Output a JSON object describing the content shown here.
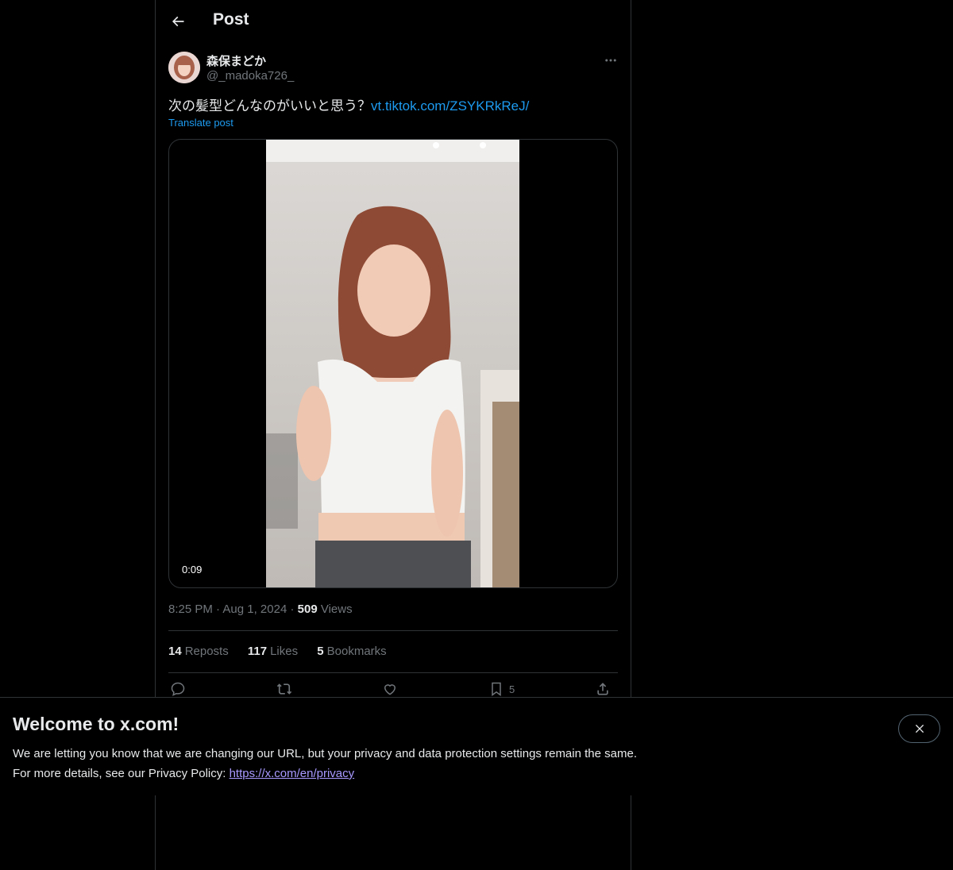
{
  "header": {
    "title": "Post",
    "back_icon": "arrow-left-icon"
  },
  "author": {
    "display_name": "森保まどか",
    "handle": "@_madoka726_"
  },
  "post": {
    "text": "次の髪型どんなのがいいと思う？",
    "link_text": "vt.tiktok.com/ZSYKRkReJ/",
    "translate_label": "Translate post"
  },
  "media": {
    "duration": "0:09"
  },
  "meta": {
    "time": "8:25 PM",
    "date": "Aug 1, 2024",
    "views_count": "509",
    "views_label": "Views",
    "sep": "·"
  },
  "stats": {
    "reposts_count": "14",
    "reposts_label": "Reposts",
    "likes_count": "117",
    "likes_label": "Likes",
    "bookmarks_count": "5",
    "bookmarks_label": "Bookmarks"
  },
  "actions": {
    "bookmark_count": "5"
  },
  "banner": {
    "title": "Welcome to x.com!",
    "line1": "We are letting you know that we are changing our URL, but your privacy and data protection settings remain the same.",
    "line2_prefix": "For more details, see our Privacy Policy: ",
    "link_text": "https://x.com/en/privacy"
  },
  "colors": {
    "background": "#000000",
    "text": "#e7e9ea",
    "secondary": "#71767b",
    "link": "#1d9bf0",
    "border": "#2f3336"
  }
}
